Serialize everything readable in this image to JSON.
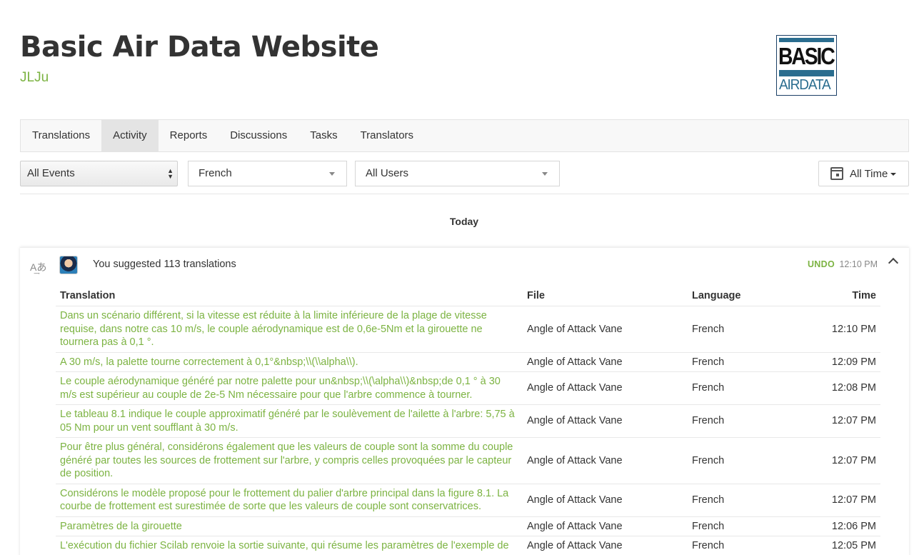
{
  "header": {
    "title": "Basic Air Data Website",
    "subtitle": "JLJu"
  },
  "logo": {
    "line1": "BASIC",
    "line2": "AIRDATA"
  },
  "tabs": [
    {
      "label": "Translations"
    },
    {
      "label": "Activity"
    },
    {
      "label": "Reports"
    },
    {
      "label": "Discussions"
    },
    {
      "label": "Tasks"
    },
    {
      "label": "Translators"
    }
  ],
  "filters": {
    "events": "All Events",
    "language": "French",
    "users": "All Users",
    "time": "All Time"
  },
  "day_label": "Today",
  "activity": {
    "summary": "You suggested 113 translations",
    "undo_label": "UNDO",
    "time": "12:10 PM",
    "icon": "translate-icon",
    "columns": {
      "translation": "Translation",
      "file": "File",
      "language": "Language",
      "time": "Time"
    },
    "rows": [
      {
        "text": "Dans un scénario différent, si la vitesse est réduite à la limite inférieure de la plage de vitesse requise, dans notre cas 10 m/s, le couple aérodynamique est de 0,6e-5Nm et la girouette ne tournera pas à 0,1 °.",
        "file": "Angle of Attack Vane",
        "language": "French",
        "time": "12:10 PM"
      },
      {
        "text": "A 30 m/s, la palette tourne correctement à 0,1°&nbsp;\\\\(\\\\alpha\\\\).",
        "file": "Angle of Attack Vane",
        "language": "French",
        "time": "12:09 PM"
      },
      {
        "text": "Le couple aérodynamique généré par notre palette pour un&nbsp;\\\\(\\alpha\\\\)&nbsp;de 0,1 ° à 30 m/s est supérieur au couple de 2e-5 Nm nécessaire pour que l'arbre commence à tourner.",
        "file": "Angle of Attack Vane",
        "language": "French",
        "time": "12:08 PM"
      },
      {
        "text": "Le tableau 8.1 indique le couple approximatif généré par le soulèvement de l'ailette à l'arbre: 5,75 à 05 Nm pour un vent soufflant à 30 m/s.",
        "file": "Angle of Attack Vane",
        "language": "French",
        "time": "12:07 PM"
      },
      {
        "text": "Pour être plus général, considérons également que les valeurs de couple sont la somme du couple généré par toutes les sources de frottement sur l'arbre, y compris celles provoquées par le capteur de position.",
        "file": "Angle of Attack Vane",
        "language": "French",
        "time": "12:07 PM"
      },
      {
        "text": "Considérons le modèle proposé pour le frottement du palier d'arbre principal dans la figure 8.1. La courbe de frottement est surestimée de sorte que les valeurs de couple sont conservatrices.",
        "file": "Angle of Attack Vane",
        "language": "French",
        "time": "12:07 PM"
      },
      {
        "text": "Paramètres de la girouette",
        "file": "Angle of Attack Vane",
        "language": "French",
        "time": "12:06 PM"
      },
      {
        "text": "L'exécution du fichier Scilab renvoie la sortie suivante, qui résume les paramètres de l'exemple de",
        "file": "Angle of Attack Vane",
        "language": "French",
        "time": "12:05 PM"
      }
    ]
  },
  "colors": {
    "accent_green": "#7cb342",
    "logo_blue": "#2a6d8f"
  }
}
